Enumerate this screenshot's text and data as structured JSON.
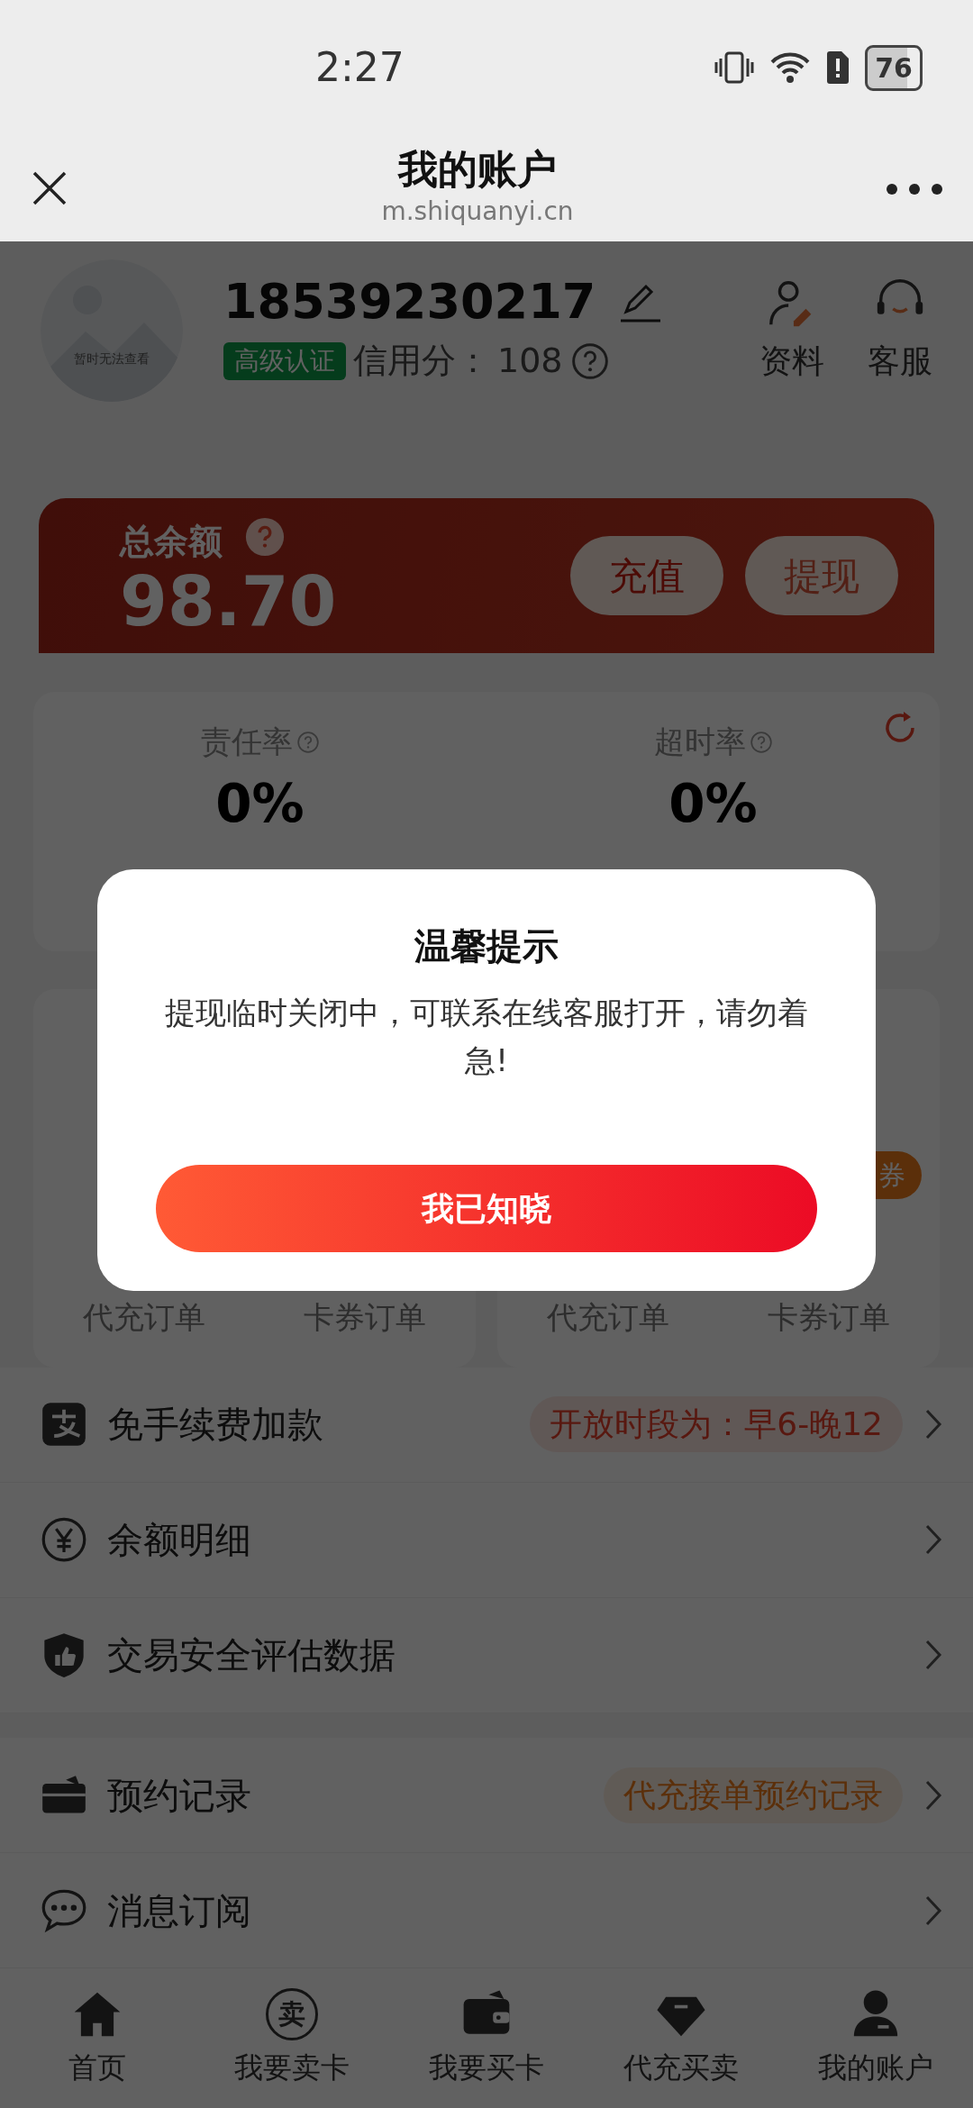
{
  "status_bar": {
    "time": "2:27",
    "battery": "76"
  },
  "browser": {
    "title": "我的账户",
    "url": "m.shiquanyi.cn"
  },
  "profile": {
    "avatar_caption": "暂时无法查看",
    "phone": "18539230217",
    "badge": "高级认证",
    "credit_label": "信用分：",
    "credit_value": "108",
    "actions": [
      {
        "label": "资料"
      },
      {
        "label": "客服"
      }
    ]
  },
  "balance": {
    "label": "总余额",
    "amount": "98.70",
    "buttons": [
      {
        "label": "充值"
      },
      {
        "label": "提现"
      }
    ]
  },
  "rates": [
    {
      "label": "责任率",
      "value": "0%"
    },
    {
      "label": "超时率",
      "value": "0%"
    }
  ],
  "order_cards": [
    {
      "links": [
        "代充订单",
        "卡券订单"
      ]
    },
    {
      "badge": "券",
      "links": [
        "代充订单",
        "卡券订单"
      ]
    }
  ],
  "menu_groups": [
    [
      {
        "label": "免手续费加款",
        "tag": "开放时段为：早6-晚12",
        "kind": "alert"
      },
      {
        "label": "余额明细"
      },
      {
        "label": "交易安全评估数据"
      }
    ],
    [
      {
        "label": "预约记录",
        "tag": "代充接单预约记录",
        "kind": "note"
      },
      {
        "label": "消息订阅"
      }
    ]
  ],
  "bottom_nav": [
    {
      "label": "首页"
    },
    {
      "label": "我要卖卡",
      "icon_text": "卖"
    },
    {
      "label": "我要买卡"
    },
    {
      "label": "代充买卖"
    },
    {
      "label": "我的账户"
    }
  ],
  "dialog": {
    "backdrop": true,
    "title": "温馨提示",
    "message": "提现临时关闭中，可联系在线客服打开，请勿着急!",
    "button": "我已知晓"
  }
}
